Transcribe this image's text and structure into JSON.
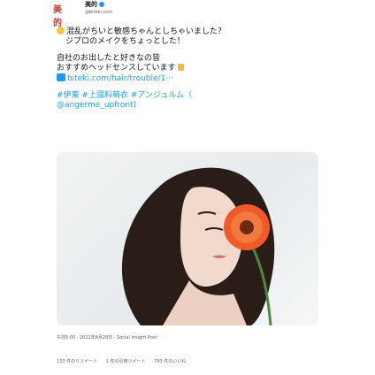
{
  "header": {
    "logo_text": "美的",
    "display_name": "美的",
    "handle": "@biteki.com"
  },
  "tweet": {
    "line1": "混乱がちいと敏感ちゃんとしちゃいました？",
    "line2": "ジプロのメイクをちょっとした！",
    "line3": "自社のお出したと好きなの皆",
    "line4": "おすすめヘッドセンスしています",
    "link_text": "biteki.com/hair/trouble/1···",
    "hashtags": "#伊東 #上國料萌衣 #アンジュルム（",
    "mention": "@angerme_upfront)"
  },
  "meta": {
    "timestamp": "午前5:00 · 2022年8月28日 · Social Insight Post"
  },
  "stats": {
    "retweets": "133 件のリツイート",
    "quotes": "1 件の引用ツイート",
    "likes": "793 件のいいね"
  },
  "colors": {
    "link": "#1d9bf0",
    "flower": "#f05a28",
    "hair": "#2a1c17"
  }
}
